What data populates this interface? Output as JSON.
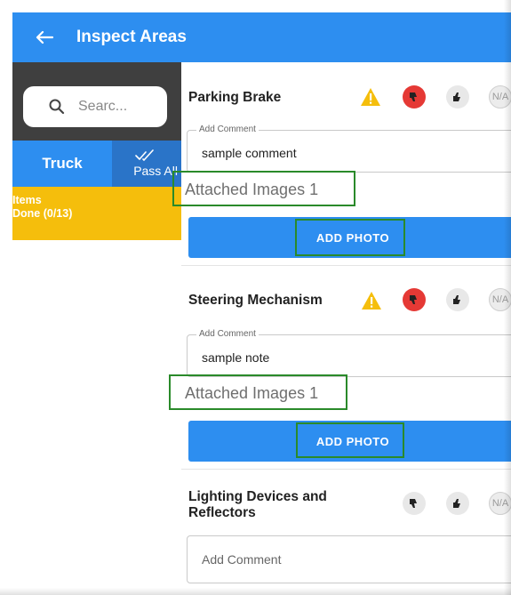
{
  "appbar": {
    "title": "Inspect Areas",
    "back_icon": "back-arrow-icon"
  },
  "sidebar": {
    "search_placeholder": "Searc...",
    "tab_truck": "Truck",
    "tab_pass_all": "Pass All",
    "items_label": "Items",
    "items_done": "Done (0/13)"
  },
  "items": [
    {
      "title": "Parking Brake",
      "comment_legend": "Add Comment",
      "comment_value": "sample comment",
      "attached": "Attached Images 1",
      "button": "ADD PHOTO",
      "na_label": "N/A"
    },
    {
      "title": "Steering Mechanism",
      "comment_legend": "Add Comment",
      "comment_value": "sample note",
      "attached": "Attached Images 1",
      "button": "ADD PHOTO",
      "na_label": "N/A"
    },
    {
      "title_line1": "Lighting Devices and",
      "title_line2": "Reflectors",
      "comment_placeholder": "Add Comment",
      "na_label": "N/A"
    }
  ],
  "colors": {
    "primary": "#2d8ef0",
    "pass_all": "#2a74c8",
    "warning": "#f5be0c",
    "fail": "#e53935",
    "highlight": "#2a8a2a",
    "search_bg": "#3f3f3f"
  }
}
